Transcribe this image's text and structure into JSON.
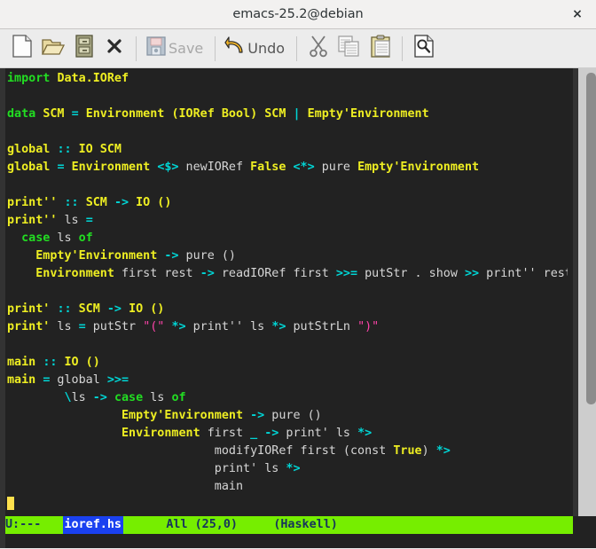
{
  "window": {
    "title": "emacs-25.2@debian",
    "close_label": "×"
  },
  "toolbar": {
    "items": [
      {
        "name": "new-file",
        "icon": "new-file-icon",
        "label": ""
      },
      {
        "name": "open-file",
        "icon": "open-folder-icon",
        "label": ""
      },
      {
        "name": "dired",
        "icon": "file-cabinet-icon",
        "label": ""
      },
      {
        "name": "close-buffer",
        "icon": "close-x-icon",
        "label": ""
      },
      {
        "name": "save",
        "icon": "save-floppy-icon",
        "label": "Save",
        "disabled": true
      },
      {
        "name": "undo",
        "icon": "undo-arrow-icon",
        "label": "Undo",
        "disabled": false
      },
      {
        "name": "cut",
        "icon": "scissors-icon",
        "label": ""
      },
      {
        "name": "copy",
        "icon": "copy-pages-icon",
        "label": ""
      },
      {
        "name": "paste",
        "icon": "clipboard-icon",
        "label": ""
      },
      {
        "name": "search",
        "icon": "magnifier-page-icon",
        "label": ""
      }
    ]
  },
  "buffer": {
    "lines": [
      [
        {
          "t": "import",
          "c": "kw"
        },
        {
          "t": " ",
          "c": "pl"
        },
        {
          "t": "Data.IORef",
          "c": "ty"
        }
      ],
      [],
      [
        {
          "t": "data",
          "c": "kw"
        },
        {
          "t": " ",
          "c": "pl"
        },
        {
          "t": "SCM",
          "c": "ty"
        },
        {
          "t": " ",
          "c": "pl"
        },
        {
          "t": "=",
          "c": "op"
        },
        {
          "t": " ",
          "c": "pl"
        },
        {
          "t": "Environment",
          "c": "ty"
        },
        {
          "t": " ",
          "c": "pl"
        },
        {
          "t": "(IORef Bool)",
          "c": "ty"
        },
        {
          "t": " ",
          "c": "pl"
        },
        {
          "t": "SCM",
          "c": "ty"
        },
        {
          "t": " ",
          "c": "pl"
        },
        {
          "t": "|",
          "c": "op"
        },
        {
          "t": " ",
          "c": "pl"
        },
        {
          "t": "Empty'Environment",
          "c": "ty"
        }
      ],
      [],
      [
        {
          "t": "global",
          "c": "ty"
        },
        {
          "t": " ",
          "c": "pl"
        },
        {
          "t": "::",
          "c": "op"
        },
        {
          "t": " ",
          "c": "pl"
        },
        {
          "t": "IO SCM",
          "c": "ty"
        }
      ],
      [
        {
          "t": "global",
          "c": "ty"
        },
        {
          "t": " ",
          "c": "pl"
        },
        {
          "t": "=",
          "c": "op"
        },
        {
          "t": " ",
          "c": "pl"
        },
        {
          "t": "Environment",
          "c": "ty"
        },
        {
          "t": " ",
          "c": "pl"
        },
        {
          "t": "<$>",
          "c": "op"
        },
        {
          "t": " newIORef ",
          "c": "pl"
        },
        {
          "t": "False",
          "c": "ty"
        },
        {
          "t": " ",
          "c": "pl"
        },
        {
          "t": "<*>",
          "c": "op"
        },
        {
          "t": " pure ",
          "c": "pl"
        },
        {
          "t": "Empty'Environment",
          "c": "ty"
        }
      ],
      [],
      [
        {
          "t": "print''",
          "c": "ty"
        },
        {
          "t": " ",
          "c": "pl"
        },
        {
          "t": "::",
          "c": "op"
        },
        {
          "t": " ",
          "c": "pl"
        },
        {
          "t": "SCM",
          "c": "ty"
        },
        {
          "t": " ",
          "c": "pl"
        },
        {
          "t": "->",
          "c": "op"
        },
        {
          "t": " ",
          "c": "pl"
        },
        {
          "t": "IO ()",
          "c": "ty"
        }
      ],
      [
        {
          "t": "print''",
          "c": "ty"
        },
        {
          "t": " ls ",
          "c": "pl"
        },
        {
          "t": "=",
          "c": "op"
        }
      ],
      [
        {
          "t": "  ",
          "c": "pl"
        },
        {
          "t": "case",
          "c": "kw"
        },
        {
          "t": " ls ",
          "c": "pl"
        },
        {
          "t": "of",
          "c": "kw"
        }
      ],
      [
        {
          "t": "    ",
          "c": "pl"
        },
        {
          "t": "Empty'Environment",
          "c": "ty"
        },
        {
          "t": " ",
          "c": "pl"
        },
        {
          "t": "->",
          "c": "op"
        },
        {
          "t": " pure ()",
          "c": "pl"
        }
      ],
      [
        {
          "t": "    ",
          "c": "pl"
        },
        {
          "t": "Environment",
          "c": "ty"
        },
        {
          "t": " first rest ",
          "c": "pl"
        },
        {
          "t": "->",
          "c": "op"
        },
        {
          "t": " readIORef first ",
          "c": "pl"
        },
        {
          "t": ">>=",
          "c": "op"
        },
        {
          "t": " putStr . show ",
          "c": "pl"
        },
        {
          "t": ">>",
          "c": "op"
        },
        {
          "t": " print'' rest",
          "c": "pl"
        }
      ],
      [],
      [
        {
          "t": "print'",
          "c": "ty"
        },
        {
          "t": " ",
          "c": "pl"
        },
        {
          "t": "::",
          "c": "op"
        },
        {
          "t": " ",
          "c": "pl"
        },
        {
          "t": "SCM",
          "c": "ty"
        },
        {
          "t": " ",
          "c": "pl"
        },
        {
          "t": "->",
          "c": "op"
        },
        {
          "t": " ",
          "c": "pl"
        },
        {
          "t": "IO ()",
          "c": "ty"
        }
      ],
      [
        {
          "t": "print'",
          "c": "ty"
        },
        {
          "t": " ls ",
          "c": "pl"
        },
        {
          "t": "=",
          "c": "op"
        },
        {
          "t": " putStr ",
          "c": "pl"
        },
        {
          "t": "\"(\"",
          "c": "str"
        },
        {
          "t": " ",
          "c": "pl"
        },
        {
          "t": "*>",
          "c": "op"
        },
        {
          "t": " print'' ls ",
          "c": "pl"
        },
        {
          "t": "*>",
          "c": "op"
        },
        {
          "t": " putStrLn ",
          "c": "pl"
        },
        {
          "t": "\")\"",
          "c": "str"
        }
      ],
      [],
      [
        {
          "t": "main",
          "c": "ty"
        },
        {
          "t": " ",
          "c": "pl"
        },
        {
          "t": "::",
          "c": "op"
        },
        {
          "t": " ",
          "c": "pl"
        },
        {
          "t": "IO ()",
          "c": "ty"
        }
      ],
      [
        {
          "t": "main",
          "c": "ty"
        },
        {
          "t": " ",
          "c": "pl"
        },
        {
          "t": "=",
          "c": "op"
        },
        {
          "t": " global ",
          "c": "pl"
        },
        {
          "t": ">>=",
          "c": "op"
        }
      ],
      [
        {
          "t": "        ",
          "c": "pl"
        },
        {
          "t": "\\",
          "c": "op"
        },
        {
          "t": "ls ",
          "c": "pl"
        },
        {
          "t": "->",
          "c": "op"
        },
        {
          "t": " ",
          "c": "pl"
        },
        {
          "t": "case",
          "c": "kw"
        },
        {
          "t": " ls ",
          "c": "pl"
        },
        {
          "t": "of",
          "c": "kw"
        }
      ],
      [
        {
          "t": "                ",
          "c": "pl"
        },
        {
          "t": "Empty'Environment",
          "c": "ty"
        },
        {
          "t": " ",
          "c": "pl"
        },
        {
          "t": "->",
          "c": "op"
        },
        {
          "t": " pure ()",
          "c": "pl"
        }
      ],
      [
        {
          "t": "                ",
          "c": "pl"
        },
        {
          "t": "Environment",
          "c": "ty"
        },
        {
          "t": " first ",
          "c": "pl"
        },
        {
          "t": "_",
          "c": "op"
        },
        {
          "t": " ",
          "c": "pl"
        },
        {
          "t": "->",
          "c": "op"
        },
        {
          "t": " print' ls ",
          "c": "pl"
        },
        {
          "t": "*>",
          "c": "op"
        }
      ],
      [
        {
          "t": "                             modifyIORef first (const ",
          "c": "pl"
        },
        {
          "t": "True",
          "c": "ty"
        },
        {
          "t": ") ",
          "c": "pl"
        },
        {
          "t": "*>",
          "c": "op"
        }
      ],
      [
        {
          "t": "                             print' ls ",
          "c": "pl"
        },
        {
          "t": "*>",
          "c": "op"
        }
      ],
      [
        {
          "t": "                             main",
          "c": "pl"
        }
      ],
      [
        {
          "t": "",
          "c": "cursor"
        }
      ]
    ]
  },
  "modeline": {
    "status": "U:---",
    "filename": "ioref.hs",
    "position": "All (25,0)",
    "major_mode": "(Haskell)",
    "bg_color": "#76ee00",
    "fg_color": "#16335c",
    "filename_bg": "#1a41f0",
    "filename_fg": "#ffffff"
  },
  "scrollbar": {
    "thumb_top_pct": 1,
    "thumb_height_pct": 74
  }
}
